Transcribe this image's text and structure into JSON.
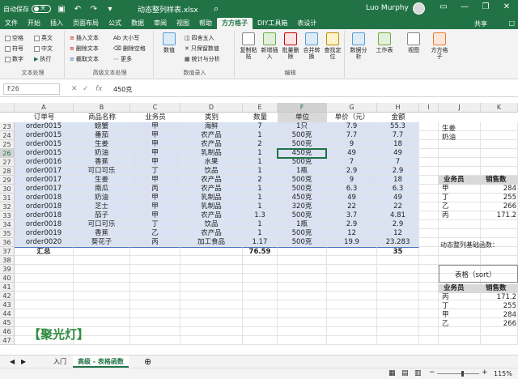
{
  "titlebar": {
    "autosave": "自动保存",
    "toggle": "关",
    "filename": "动态整列样表.xlsx",
    "user": "Luo Murphy",
    "min": "—",
    "restore": "❐",
    "close": "✕"
  },
  "tabs": [
    "文件",
    "开始",
    "插入",
    "页面布局",
    "公式",
    "数据",
    "审阅",
    "视图",
    "帮助",
    "方方格子",
    "DIY工具箱",
    "表设计"
  ],
  "share": "共享",
  "comment": "□",
  "ribbon": {
    "text_group": {
      "items": [
        "空格",
        "英文",
        "符号",
        "中文",
        "数字",
        "执行"
      ],
      "name": "文本处理"
    },
    "adv_group": {
      "items": [
        "插入文本",
        "删除文本",
        "截取文本",
        "大小写",
        "删除空格",
        "更多"
      ],
      "name": "高级文本处理"
    },
    "num_group": {
      "items": [
        "数值",
        "四舍五入",
        "只保留数值",
        "统计与分析"
      ],
      "name": "数值录入"
    },
    "edit_group": {
      "items": [
        "复制粘贴",
        "新增插入",
        "批量删除",
        "合并转换",
        "查找定位"
      ],
      "name": "编辑"
    },
    "right_group": {
      "items": [
        "数据分析",
        "工作表",
        "视图",
        "方方格子"
      ]
    }
  },
  "formula_bar": {
    "name_box": "F26",
    "fx": "fx",
    "value": "450克"
  },
  "grid": {
    "col_letters": [
      "A",
      "B",
      "C",
      "D",
      "E",
      "F",
      "G",
      "H",
      "I",
      "J",
      "K"
    ],
    "headers": [
      "订单号",
      "商品名称",
      "业务员",
      "类别",
      "数量",
      "单位",
      "单价（元）",
      "金额"
    ],
    "rows": [
      {
        "n": "23",
        "c": [
          "order0015",
          "螃蟹",
          "甲",
          "海鲜",
          "7",
          "1只",
          "7.9",
          "55.3"
        ]
      },
      {
        "n": "24",
        "c": [
          "order0015",
          "番茄",
          "甲",
          "农产品",
          "1",
          "500克",
          "7.7",
          "7.7"
        ]
      },
      {
        "n": "25",
        "c": [
          "order0015",
          "生姜",
          "甲",
          "农产品",
          "2",
          "500克",
          "9",
          "18"
        ]
      },
      {
        "n": "26",
        "c": [
          "order0015",
          "奶油",
          "甲",
          "乳制品",
          "1",
          "450克",
          "49",
          "49"
        ]
      },
      {
        "n": "27",
        "c": [
          "order0016",
          "香蕉",
          "甲",
          "水果",
          "1",
          "500克",
          "7",
          "7"
        ]
      },
      {
        "n": "28",
        "c": [
          "order0017",
          "可口可乐",
          "丁",
          "饮品",
          "1",
          "1瓶",
          "2.9",
          "2.9"
        ]
      },
      {
        "n": "29",
        "c": [
          "order0017",
          "生姜",
          "甲",
          "农产品",
          "2",
          "500克",
          "9",
          "18"
        ]
      },
      {
        "n": "30",
        "c": [
          "order0017",
          "南瓜",
          "丙",
          "农产品",
          "1",
          "500克",
          "6.3",
          "6.3"
        ]
      },
      {
        "n": "31",
        "c": [
          "order0018",
          "奶油",
          "甲",
          "乳制品",
          "1",
          "450克",
          "49",
          "49"
        ]
      },
      {
        "n": "32",
        "c": [
          "order0018",
          "芝士",
          "甲",
          "乳制品",
          "1",
          "320克",
          "22",
          "22"
        ]
      },
      {
        "n": "33",
        "c": [
          "order0018",
          "茄子",
          "甲",
          "农产品",
          "1.3",
          "500克",
          "3.7",
          "4.81"
        ]
      },
      {
        "n": "34",
        "c": [
          "order0018",
          "可口可乐",
          "丁",
          "饮品",
          "1",
          "1瓶",
          "2.9",
          "2.9"
        ]
      },
      {
        "n": "35",
        "c": [
          "order0019",
          "香蕉",
          "乙",
          "农产品",
          "1",
          "500克",
          "12",
          "12"
        ]
      },
      {
        "n": "36",
        "c": [
          "order0020",
          "葵花子",
          "丙",
          "加工食品",
          "1.17",
          "500克",
          "19.9",
          "23.283"
        ]
      },
      {
        "n": "37",
        "c": [
          "汇总",
          "",
          "",
          "",
          "76.59",
          "",
          "",
          "35"
        ]
      },
      {
        "n": "38",
        "c": [
          "",
          "",
          "",
          "",
          "",
          "",
          "",
          ""
        ]
      },
      {
        "n": "39",
        "c": [
          "",
          "",
          "",
          "",
          "",
          "",
          "",
          ""
        ]
      },
      {
        "n": "40",
        "c": [
          "",
          "",
          "",
          "",
          "",
          "",
          "",
          ""
        ]
      },
      {
        "n": "41",
        "c": [
          "",
          "",
          "",
          "",
          "",
          "",
          "",
          ""
        ]
      },
      {
        "n": "42",
        "c": [
          "",
          "",
          "",
          "",
          "",
          "",
          "",
          ""
        ]
      },
      {
        "n": "43",
        "c": [
          "",
          "",
          "",
          "",
          "",
          "",
          "",
          ""
        ]
      },
      {
        "n": "44",
        "c": [
          "",
          "",
          "",
          "",
          "",
          "",
          "",
          ""
        ]
      },
      {
        "n": "45",
        "c": [
          "",
          "",
          "",
          "",
          "",
          "",
          "",
          ""
        ]
      },
      {
        "n": "46",
        "c": [
          "",
          "",
          "",
          "",
          "",
          "",
          "",
          ""
        ]
      },
      {
        "n": "47",
        "c": [
          "",
          "",
          "",
          "",
          "",
          "",
          "",
          ""
        ]
      }
    ],
    "right_panel": {
      "list_top": [
        "生姜",
        "奶油"
      ],
      "table1_headers": [
        "业务员",
        "销售数"
      ],
      "table1_rows": [
        [
          "甲",
          "284"
        ],
        [
          "丁",
          "255"
        ],
        [
          "乙",
          "266"
        ],
        [
          "丙",
          "171.2"
        ]
      ],
      "func_note": "动态整列基础函数：",
      "sort_label": "表格（sort）",
      "table2_headers": [
        "业务员",
        "销售数"
      ],
      "table2_rows": [
        [
          "丙",
          "171.2"
        ],
        [
          "丁",
          "255"
        ],
        [
          "甲",
          "284"
        ],
        [
          "乙",
          "266"
        ]
      ]
    }
  },
  "spotlight": "【聚光灯】",
  "sheets": [
    "入门",
    "高级 - 表格函数"
  ],
  "add_sheet": "⊕",
  "status": {
    "zoom": "115%"
  }
}
